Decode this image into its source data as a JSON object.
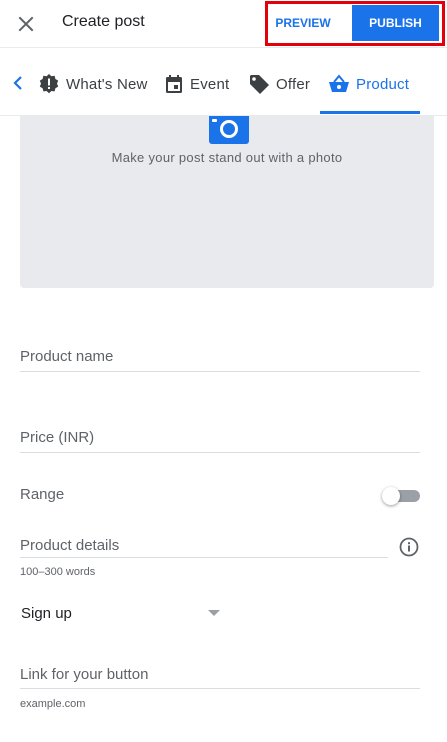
{
  "header": {
    "title": "Create post",
    "preview_label": "PREVIEW",
    "publish_label": "PUBLISH"
  },
  "tabs": [
    {
      "label": "What's New",
      "icon": "alert-badge-icon",
      "active": false
    },
    {
      "label": "Event",
      "icon": "calendar-icon",
      "active": false
    },
    {
      "label": "Offer",
      "icon": "tag-icon",
      "active": false
    },
    {
      "label": "Product",
      "icon": "shopping-basket-icon",
      "active": true
    }
  ],
  "photo": {
    "prompt": "Make your post stand out with a photo"
  },
  "form": {
    "product_name_label": "Product name",
    "price_label": "Price (INR)",
    "range_label": "Range",
    "range_enabled": false,
    "details_label": "Product details",
    "details_helper": "100–300 words",
    "button_type_value": "Sign up",
    "link_label": "Link for your button",
    "link_helper": "example.com"
  },
  "colors": {
    "accent": "#1a73e8",
    "highlight_border": "#e3000b",
    "photo_bg": "#e8eaed"
  }
}
